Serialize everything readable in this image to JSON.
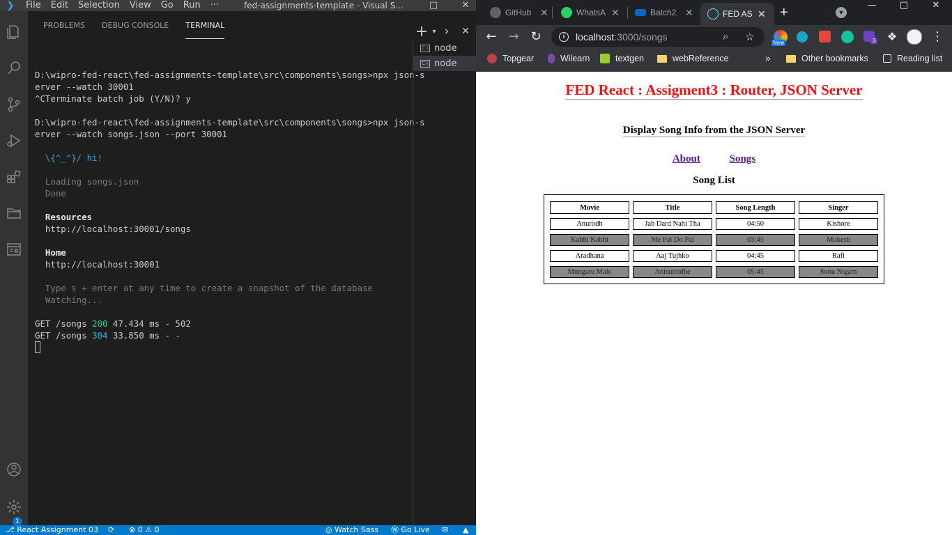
{
  "vscode": {
    "menu": [
      "File",
      "Edit",
      "Selection",
      "View",
      "Go",
      "Run",
      "···"
    ],
    "window_title": "fed-assignments-template - Visual S...",
    "panel_tabs": [
      "PROBLEMS",
      "DEBUG CONSOLE",
      "TERMINAL"
    ],
    "terminal_lines": [
      "",
      "D:\\wipro-fed-react\\fed-assignments-template\\src\\components\\songs>npx json-s",
      "erver --watch 30001",
      "^CTerminate batch job (Y/N)? y",
      "",
      "D:\\wipro-fed-react\\fed-assignments-template\\src\\components\\songs>npx json-s",
      "erver --watch songs.json --port 30001",
      "",
      "  \\{^_^}/ hi!",
      "",
      "  Loading songs.json",
      "  Done",
      "",
      "  Resources",
      "  http://localhost:30001/songs",
      "",
      "  Home",
      "  http://localhost:30001",
      "",
      "  Type s + enter at any time to create a snapshot of the database",
      "  Watching...",
      ""
    ],
    "request_lines": [
      {
        "pre": "GET /songs ",
        "status": "200",
        "post": " 47.434 ms - 502",
        "status_color": "#23d18b"
      },
      {
        "pre": "GET /songs ",
        "status": "304",
        "post": " 33.850 ms - -",
        "status_color": "#29b8db"
      }
    ],
    "terminal_instances": [
      "node",
      "node"
    ],
    "terminal_icon_text": "C:\\",
    "status": {
      "left": "React Assignment 03",
      "problems": "⊗ 0 ⚠ 0",
      "watch_sass": "Watch Sass",
      "go_live": "Go Live"
    },
    "settings_badge": "1"
  },
  "chrome": {
    "tabs": [
      {
        "title": "GitHub",
        "color": "#5f6368"
      },
      {
        "title": "WhatsApp",
        "color": "#25d366"
      },
      {
        "title": "Batch2",
        "color": "#0a66c2"
      },
      {
        "title": "FED AS",
        "color": "#61dafb"
      }
    ],
    "url": {
      "host": "localhost",
      "path": ":3000/songs"
    },
    "extension_badges": {
      "new": "New",
      "count": "3"
    },
    "bookmarks": [
      "Topgear",
      "Wilearn",
      "textgen",
      "webReference"
    ],
    "other_bookmarks": "Other bookmarks",
    "reading_list": "Reading list",
    "more": "»"
  },
  "page": {
    "title": "FED React : Assigment3 : Router, JSON Server",
    "subtitle": "Display Song Info from the JSON Server",
    "nav": [
      "About",
      "Songs"
    ],
    "list_title": "Song List",
    "columns": [
      "Movie",
      "Title",
      "Song Length",
      "Singer"
    ],
    "rows": [
      [
        "Anurodh",
        "Jab Dard Nahi Tha",
        "04:50",
        "Kishore"
      ],
      [
        "Kabhi Kabhi",
        "Me Pal Do Pal",
        "03:45",
        "Mukesh"
      ],
      [
        "Aradhana",
        "Aaj Tujhko",
        "04:45",
        "Rafi"
      ],
      [
        "Mungaru Male",
        "Anisuthidhe",
        "05:45",
        "Sonu Nigam"
      ]
    ]
  }
}
